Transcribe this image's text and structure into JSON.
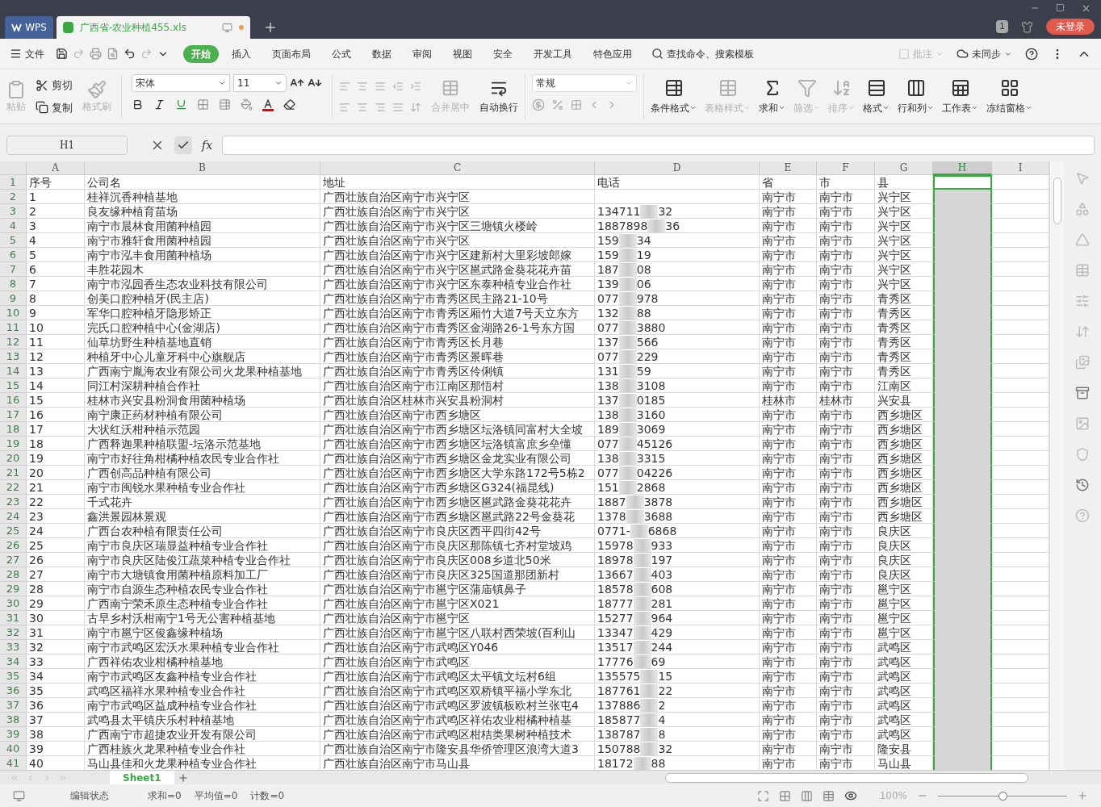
{
  "title_bar": {
    "app_tab": "WPS",
    "doc_tab": "广西省-农业种植455.xls",
    "badge": "1",
    "login": "未登录"
  },
  "menu": {
    "file": "文件",
    "tabs": [
      {
        "label": "开始",
        "selected": true
      },
      {
        "label": "插入",
        "selected": false
      },
      {
        "label": "页面布局",
        "selected": false
      },
      {
        "label": "公式",
        "selected": false
      },
      {
        "label": "数据",
        "selected": false
      },
      {
        "label": "审阅",
        "selected": false
      },
      {
        "label": "视图",
        "selected": false
      },
      {
        "label": "安全",
        "selected": false
      },
      {
        "label": "开发工具",
        "selected": false
      },
      {
        "label": "特色应用",
        "selected": false
      }
    ],
    "search": "查找命令、搜索模板",
    "comment": "批注",
    "sync": "未同步"
  },
  "ribbon": {
    "paste": {
      "label": "粘贴",
      "disabled": true
    },
    "cut": {
      "label": "剪切",
      "disabled": false
    },
    "copy": {
      "label": "复制",
      "disabled": false
    },
    "format_painter": {
      "label": "格式刷",
      "disabled": true
    },
    "font_name": "宋体",
    "font_size": "11",
    "merge": {
      "label": "合并居中",
      "disabled": true
    },
    "wrap": {
      "label": "自动换行",
      "disabled": false
    },
    "number_format": "常规",
    "large_buttons": [
      {
        "label": "条件格式",
        "disabled": false,
        "kind": "cond"
      },
      {
        "label": "表格样式",
        "disabled": true,
        "kind": "style"
      },
      {
        "label": "求和",
        "disabled": false,
        "kind": "sum"
      },
      {
        "label": "筛选",
        "disabled": true,
        "kind": "filter"
      },
      {
        "label": "排序",
        "disabled": true,
        "kind": "sort"
      },
      {
        "label": "格式",
        "disabled": false,
        "kind": "format"
      },
      {
        "label": "行和列",
        "disabled": false,
        "kind": "rowcol"
      },
      {
        "label": "工作表",
        "disabled": false,
        "kind": "sheet"
      },
      {
        "label": "冻结窗格",
        "disabled": false,
        "kind": "freeze"
      }
    ]
  },
  "formula_bar": {
    "name_box": "H1",
    "fx": "fx"
  },
  "columns": [
    {
      "label": "A",
      "selected": false
    },
    {
      "label": "B",
      "selected": false
    },
    {
      "label": "C",
      "selected": false
    },
    {
      "label": "D",
      "selected": false
    },
    {
      "label": "E",
      "selected": false
    },
    {
      "label": "F",
      "selected": false
    },
    {
      "label": "G",
      "selected": false
    },
    {
      "label": "H",
      "selected": true
    },
    {
      "label": "I",
      "selected": false
    }
  ],
  "header_row": {
    "n": "1",
    "cells": [
      "序号",
      "公司名",
      "地址",
      "电话",
      "省",
      "市",
      "县"
    ]
  },
  "rows": [
    {
      "n": "2",
      "a": "1",
      "b": "桂祥沉香种植基地",
      "c": "广西壮族自治区南宁市兴宁区",
      "e": "南宁市",
      "f": "南宁市",
      "g": "兴宁区"
    },
    {
      "n": "3",
      "a": "2",
      "b": "良友缘种植育苗场",
      "c": "广西壮族自治区南宁市兴宁区",
      "d": {
        "start": "134711",
        "end": "32"
      },
      "e": "南宁市",
      "f": "南宁市",
      "g": "兴宁区"
    },
    {
      "n": "4",
      "a": "3",
      "b": "南宁市晨林食用菌种植园",
      "c": "广西壮族自治区南宁市兴宁区三塘镇火楼岭",
      "d": {
        "start": "1887898",
        "end": "36"
      },
      "e": "南宁市",
      "f": "南宁市",
      "g": "兴宁区"
    },
    {
      "n": "5",
      "a": "4",
      "b": "南宁市雅轩食用菌种植园",
      "c": "广西壮族自治区南宁市兴宁区",
      "d": {
        "start": "159",
        "end": "34"
      },
      "e": "南宁市",
      "f": "南宁市",
      "g": "兴宁区"
    },
    {
      "n": "6",
      "a": "5",
      "b": "南宁市泓丰食用菌种植场",
      "c": "广西壮族自治区南宁市兴宁区建新村大里彩坡郎嫁",
      "d": {
        "start": "159",
        "end": "19"
      },
      "e": "南宁市",
      "f": "南宁市",
      "g": "兴宁区"
    },
    {
      "n": "7",
      "a": "6",
      "b": "丰胜花园木",
      "c": "广西壮族自治区南宁市兴宁区邕武路金葵花花卉苗",
      "d": {
        "start": "187",
        "end": "08"
      },
      "e": "南宁市",
      "f": "南宁市",
      "g": "兴宁区"
    },
    {
      "n": "8",
      "a": "7",
      "b": "南宁市泓园香生态农业科技有限公司",
      "c": "广西壮族自治区南宁市兴宁区东泰种植专业合作社",
      "d": {
        "start": "139",
        "end": "06"
      },
      "e": "南宁市",
      "f": "南宁市",
      "g": "兴宁区"
    },
    {
      "n": "9",
      "a": "8",
      "b": "创美口腔种植牙(民主店)",
      "c": "广西壮族自治区南宁市青秀区民主路21-10号",
      "d": {
        "start": "077",
        "end": "978"
      },
      "e": "南宁市",
      "f": "南宁市",
      "g": "青秀区"
    },
    {
      "n": "10",
      "a": "9",
      "b": "军华口腔种植牙隐形矫正",
      "c": "广西壮族自治区南宁市青秀区厢竹大道7号天立东方",
      "d": {
        "start": "132",
        "end": "88"
      },
      "e": "南宁市",
      "f": "南宁市",
      "g": "青秀区"
    },
    {
      "n": "11",
      "a": "10",
      "b": "完氏口腔种植中心(金湖店)",
      "c": "广西壮族自治区南宁市青秀区金湖路26-1号东方国",
      "d": {
        "start": "077",
        "end": "3880"
      },
      "e": "南宁市",
      "f": "南宁市",
      "g": "青秀区"
    },
    {
      "n": "12",
      "a": "11",
      "b": "仙草坊野生种植基地直销",
      "c": "广西壮族自治区南宁市青秀区长月巷",
      "d": {
        "start": "137",
        "end": "566"
      },
      "e": "南宁市",
      "f": "南宁市",
      "g": "青秀区"
    },
    {
      "n": "13",
      "a": "12",
      "b": "种植牙中心儿童牙科中心旗舰店",
      "c": "广西壮族自治区南宁市青秀区景晖巷",
      "d": {
        "start": "077",
        "end": "229"
      },
      "e": "南宁市",
      "f": "南宁市",
      "g": "青秀区"
    },
    {
      "n": "14",
      "a": "13",
      "b": "广西南宁胤海农业有限公司火龙果种植基地",
      "c": "广西壮族自治区南宁市青秀区伶俐镇",
      "d": {
        "start": "131",
        "end": "59"
      },
      "e": "南宁市",
      "f": "南宁市",
      "g": "青秀区"
    },
    {
      "n": "15",
      "a": "14",
      "b": "同江村深耕种植合作社",
      "c": "广西壮族自治区南宁市江南区那悟村",
      "d": {
        "start": "138",
        "end": "3108"
      },
      "e": "南宁市",
      "f": "南宁市",
      "g": "江南区"
    },
    {
      "n": "16",
      "a": "15",
      "b": "桂林市兴安县粉洞食用菌种植场",
      "c": "广西壮族自治区桂林市兴安县粉洞村",
      "d": {
        "start": "137",
        "end": "0185"
      },
      "e": "桂林市",
      "f": "桂林市",
      "g": "兴安县"
    },
    {
      "n": "17",
      "a": "16",
      "b": "南宁康正药材种植有限公司",
      "c": "广西壮族自治区南宁市西乡塘区",
      "d": {
        "start": "138",
        "end": "3160"
      },
      "e": "南宁市",
      "f": "南宁市",
      "g": "西乡塘区"
    },
    {
      "n": "18",
      "a": "17",
      "b": "大状红沃柑种植示范园",
      "c": "广西壮族自治区南宁市西乡塘区坛洛镇同富村大全坡",
      "d": {
        "start": "189",
        "end": "3069"
      },
      "e": "南宁市",
      "f": "南宁市",
      "g": "西乡塘区"
    },
    {
      "n": "19",
      "a": "18",
      "b": "广西释迦果种植联盟-坛洛示范基地",
      "c": "广西壮族自治区南宁市西乡塘区坛洛镇富庶乡垒懂",
      "d": {
        "start": "077",
        "end": "45126"
      },
      "e": "南宁市",
      "f": "南宁市",
      "g": "西乡塘区"
    },
    {
      "n": "20",
      "a": "19",
      "b": "南宁市好往角柑橘种植农民专业合作社",
      "c": "广西壮族自治区南宁市西乡塘区金龙实业有限公司",
      "d": {
        "start": "138",
        "end": "3315"
      },
      "e": "南宁市",
      "f": "南宁市",
      "g": "西乡塘区"
    },
    {
      "n": "21",
      "a": "20",
      "b": "广西创高品种植有限公司",
      "c": "广西壮族自治区南宁市西乡塘区大学东路172号5栋2",
      "d": {
        "start": "077",
        "end": "04226"
      },
      "e": "南宁市",
      "f": "南宁市",
      "g": "西乡塘区"
    },
    {
      "n": "22",
      "a": "21",
      "b": "南宁市闽锐水果种植专业合作社",
      "c": "广西壮族自治区南宁市西乡塘区G324(福昆线)",
      "d": {
        "start": "151",
        "end": "2868"
      },
      "e": "南宁市",
      "f": "南宁市",
      "g": "西乡塘区"
    },
    {
      "n": "23",
      "a": "22",
      "b": "千式花卉",
      "c": "广西壮族自治区南宁市西乡塘区邕武路金葵花花卉",
      "d": {
        "start": "1887",
        "end": "3878"
      },
      "e": "南宁市",
      "f": "南宁市",
      "g": "西乡塘区"
    },
    {
      "n": "24",
      "a": "23",
      "b": "鑫洪景园林景观",
      "c": "广西壮族自治区南宁市西乡塘区邕武路22号金葵花",
      "d": {
        "start": "1378",
        "end": "3688"
      },
      "e": "南宁市",
      "f": "南宁市",
      "g": "西乡塘区"
    },
    {
      "n": "25",
      "a": "24",
      "b": "广西台农种植有限责任公司",
      "c": "广西壮族自治区南宁市良庆区西平四街42号",
      "d": {
        "start": "0771-",
        "end": "6868"
      },
      "e": "南宁市",
      "f": "南宁市",
      "g": "良庆区"
    },
    {
      "n": "26",
      "a": "25",
      "b": "南宁市良庆区瑞显益种植专业合作社",
      "c": "广西壮族自治区南宁市良庆区那陈镇七齐村堂坡鸡",
      "d": {
        "start": "15978",
        "end": "933"
      },
      "e": "南宁市",
      "f": "南宁市",
      "g": "良庆区"
    },
    {
      "n": "27",
      "a": "26",
      "b": "南宁市良庆区陆俊江蔬菜种植专业合作社",
      "c": "广西壮族自治区南宁市良庆区008乡道北50米",
      "d": {
        "start": "18978",
        "end": "197"
      },
      "e": "南宁市",
      "f": "南宁市",
      "g": "良庆区"
    },
    {
      "n": "28",
      "a": "27",
      "b": "南宁市大塘镇食用菌种植原料加工厂",
      "c": "广西壮族自治区南宁市良庆区325国道那团新村",
      "d": {
        "start": "13667",
        "end": "403"
      },
      "e": "南宁市",
      "f": "南宁市",
      "g": "良庆区"
    },
    {
      "n": "29",
      "a": "28",
      "b": "南宁市自源生态种植农民专业合作社",
      "c": "广西壮族自治区南宁市邕宁区蒲庙镇鼻子",
      "d": {
        "start": "18578",
        "end": "608"
      },
      "e": "南宁市",
      "f": "南宁市",
      "g": "邕宁区"
    },
    {
      "n": "30",
      "a": "29",
      "b": "广西南宁荣禾原生态种植专业合作社",
      "c": "广西壮族自治区南宁市邕宁区X021",
      "d": {
        "start": "18777",
        "end": "281"
      },
      "e": "南宁市",
      "f": "南宁市",
      "g": "邕宁区"
    },
    {
      "n": "31",
      "a": "30",
      "b": "古早乡村沃柑南宁1号无公害种植基地",
      "c": "广西壮族自治区南宁市邕宁区",
      "d": {
        "start": "15277",
        "end": "964"
      },
      "e": "南宁市",
      "f": "南宁市",
      "g": "邕宁区"
    },
    {
      "n": "32",
      "a": "31",
      "b": "南宁市邕宁区俊鑫缘种植场",
      "c": "广西壮族自治区南宁市邕宁区八联村西荣坡(百利山",
      "d": {
        "start": "13347",
        "end": "429"
      },
      "e": "南宁市",
      "f": "南宁市",
      "g": "邕宁区"
    },
    {
      "n": "33",
      "a": "32",
      "b": "南宁市武鸣区宏沃水果种植专业合作社",
      "c": "广西壮族自治区南宁市武鸣区Y046",
      "d": {
        "start": "13517",
        "end": "244"
      },
      "e": "南宁市",
      "f": "南宁市",
      "g": "武鸣区"
    },
    {
      "n": "34",
      "a": "33",
      "b": "广西祥佑农业柑橘种植基地",
      "c": "广西壮族自治区南宁市武鸣区",
      "d": {
        "start": "17776",
        "end": "69"
      },
      "e": "南宁市",
      "f": "南宁市",
      "g": "武鸣区"
    },
    {
      "n": "35",
      "a": "34",
      "b": "南宁市武鸣区友鑫种植专业合作社",
      "c": "广西壮族自治区南宁市武鸣区太平镇文坛村6组",
      "d": {
        "start": "135575",
        "end": "15"
      },
      "e": "南宁市",
      "f": "南宁市",
      "g": "武鸣区"
    },
    {
      "n": "36",
      "a": "35",
      "b": "武鸣区福祥水果种植专业合作社",
      "c": "广西壮族自治区南宁市武鸣区双桥镇平福小学东北",
      "d": {
        "start": "187761",
        "end": "22"
      },
      "e": "南宁市",
      "f": "南宁市",
      "g": "武鸣区"
    },
    {
      "n": "37",
      "a": "36",
      "b": "南宁市武鸣区益成种植专业合作社",
      "c": "广西壮族自治区南宁市武鸣区罗波镇板欧村兰张屯4",
      "d": {
        "start": "137886",
        "end": "2"
      },
      "e": "南宁市",
      "f": "南宁市",
      "g": "武鸣区"
    },
    {
      "n": "38",
      "a": "37",
      "b": "武鸣县太平镇庆乐村种植基地",
      "c": "广西壮族自治区南宁市武鸣区祥佑农业柑橘种植基",
      "d": {
        "start": "185877",
        "end": "4"
      },
      "e": "南宁市",
      "f": "南宁市",
      "g": "武鸣区"
    },
    {
      "n": "39",
      "a": "38",
      "b": "广西南宁市超捷农业开发有限公司",
      "c": "广西壮族自治区南宁市武鸣区柑桔类果树种植技术",
      "d": {
        "start": "138787",
        "end": "8"
      },
      "e": "南宁市",
      "f": "南宁市",
      "g": "武鸣区"
    },
    {
      "n": "40",
      "a": "39",
      "b": "广西桂族火龙果种植专业合作社",
      "c": "广西壮族自治区南宁市隆安县华侨管理区浪湾大道3",
      "d": {
        "start": "150788",
        "end": "32"
      },
      "e": "南宁市",
      "f": "南宁市",
      "g": "隆安县"
    },
    {
      "n": "41",
      "a": "40",
      "b": "马山县佳和火龙果种植专业合作社",
      "c": "广西壮族自治区南宁市马山县",
      "d": {
        "start": "18172",
        "end": "88"
      },
      "e": "南宁市",
      "f": "南宁市",
      "g": "马山县"
    }
  ],
  "sheet_tabs": [
    {
      "label": "Sheet1",
      "selected": true
    }
  ],
  "status_bar": {
    "mode": "编辑状态",
    "sum": "求和=0",
    "avg": "平均值=0",
    "count": "计数=0",
    "zoom": "100%",
    "zoom_slider": {
      "level": 0.5
    }
  }
}
